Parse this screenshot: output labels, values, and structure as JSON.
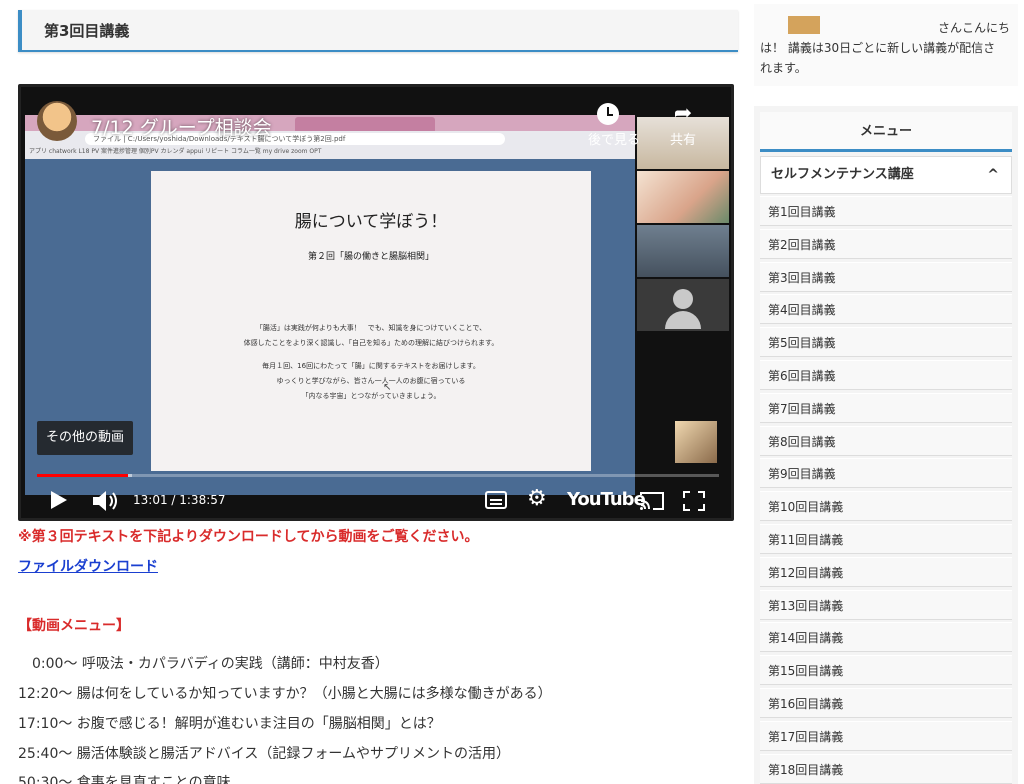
{
  "page": {
    "title": "第3回目講義"
  },
  "video": {
    "title": "7/12 グループ相談会",
    "watch_later_label": "後で見る",
    "share_label": "共有",
    "more_videos_label": "その他の動画",
    "time_display": "13:01 / 1:38:57",
    "progress": 0.133,
    "buffered": 0.14,
    "youtube_logo": "YouTube",
    "browser": {
      "url": "ファイル | C:/Users/yoshida/Downloads/テキスト腸について学ぼう第2回.pdf",
      "bookmarks": "アプリ  chatwork  L18  PV  案件進捗管理  個別PV  カレンダ  appui  リピート  コラム一覧  my drive  zoom  OPT"
    },
    "document": {
      "heading": "腸について学ぼう！",
      "subheading": "第２回「腸の働きと腸脳相関」",
      "para1_line1": "「腸活」は実践が何よりも大事！　でも、知識を身につけていくことで、",
      "para1_line2": "体感したことをより深く認識し、「自己を知る」ための理解に結びつけられます。",
      "para2_line1": "毎月１回、16回にわたって「腸」に関するテキストをお届けします。",
      "para2_line2": "ゆっくりと学びながら、皆さん一人一人のお腹に宿っている",
      "para2_line3": "「内なる宇宙」とつながっていきましょう。"
    }
  },
  "content": {
    "notice": "※第３回テキストを下記よりダウンロードしてから動画をご覧ください。",
    "download_link": "ファイルダウンロード",
    "menu_heading": "【動画メニュー】",
    "chapters": [
      "　0:00～ 呼吸法・カパラバディの実践（講師：中村友香）",
      "12:20～ 腸は何をしているか知っていますか？（小腸と大腸には多様な働きがある）",
      "17:10～ お腹で感じる！解明が進むいま注目の「腸脳相関」とは？",
      "25:40～ 腸活体験談と腸活アドバイス（記録フォームやサプリメントの活用）",
      "50:30～ 食事を見直すことの意味"
    ]
  },
  "sidebar": {
    "greeting_line1": "さんこんにち",
    "greeting_line2": "は！ 講義は30日ごとに新しい講義が配信さ",
    "greeting_line3": "れます。",
    "greeting_color": "#d4a35c",
    "menu_title": "メニュー",
    "category": "セルフメンテナンス講座",
    "category_chevron": "^",
    "items": [
      "第1回目講義",
      "第2回目講義",
      "第3回目講義",
      "第4回目講義",
      "第5回目講義",
      "第6回目講義",
      "第7回目講義",
      "第8回目講義",
      "第9回目講義",
      "第10回目講義",
      "第11回目講義",
      "第12回目講義",
      "第13回目講義",
      "第14回目講義",
      "第15回目講義",
      "第16回目講義",
      "第17回目講義",
      "第18回目講義"
    ]
  },
  "colors": {
    "accent": "#3c8dc5",
    "notice_red": "#d92b2b",
    "link_blue": "#1a3fd0",
    "progress_red": "#ff0000"
  }
}
